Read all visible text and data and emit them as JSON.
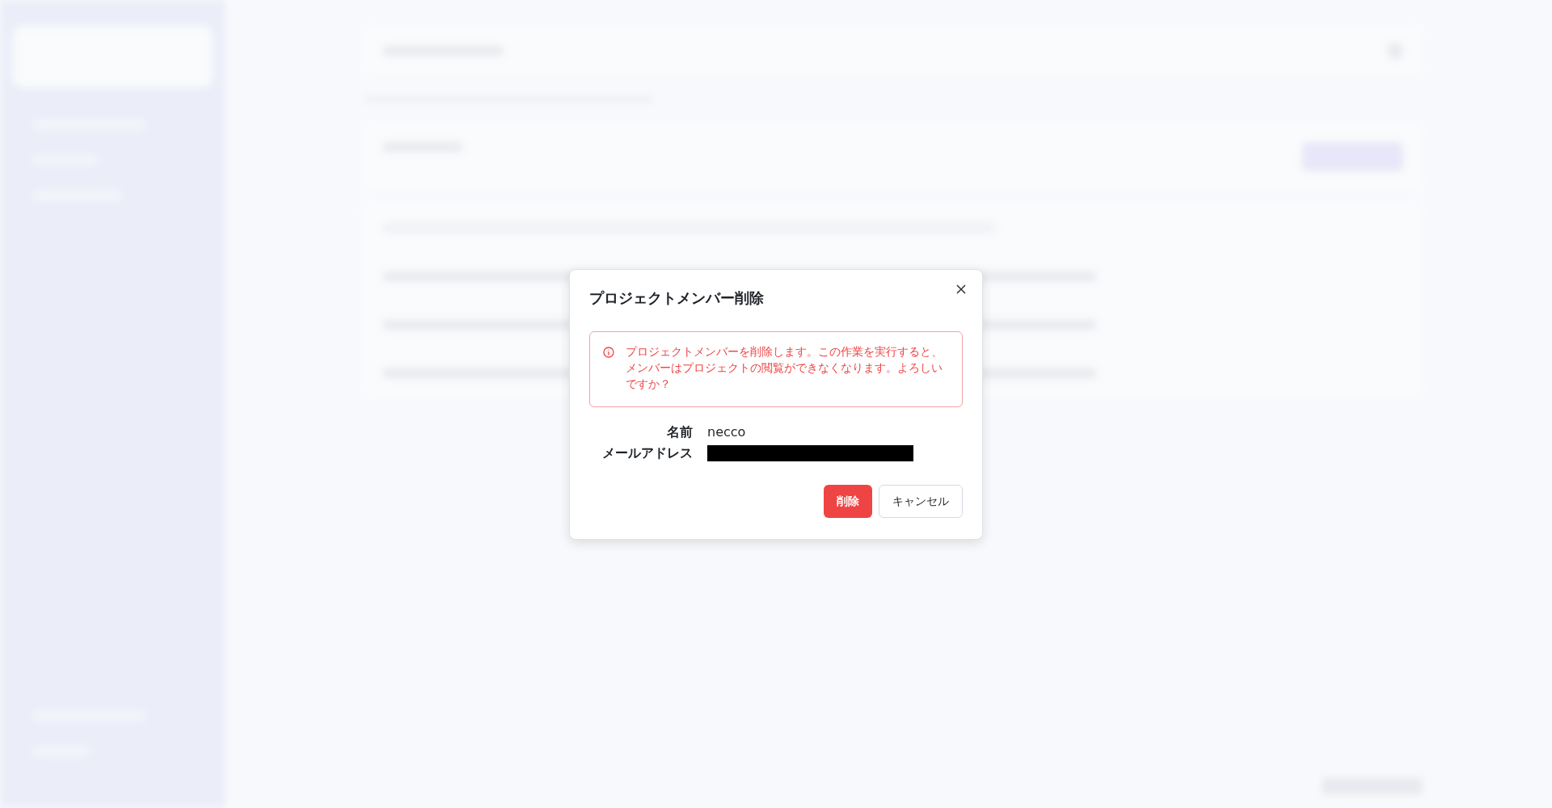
{
  "dialog": {
    "title": "プロジェクトメンバー削除",
    "alert": {
      "message": "プロジェクトメンバーを削除します。この作業を実行すると、メンバーはプロジェクトの閲覧ができなくなります。よろしいですか？"
    },
    "fields": [
      {
        "label": "名前",
        "value": "necco",
        "redacted": false
      },
      {
        "label": "メールアドレス",
        "redacted": true
      }
    ],
    "buttons": [
      {
        "label": "削除",
        "kind": "danger"
      },
      {
        "label": "キャンセル",
        "kind": "secondary"
      }
    ]
  }
}
